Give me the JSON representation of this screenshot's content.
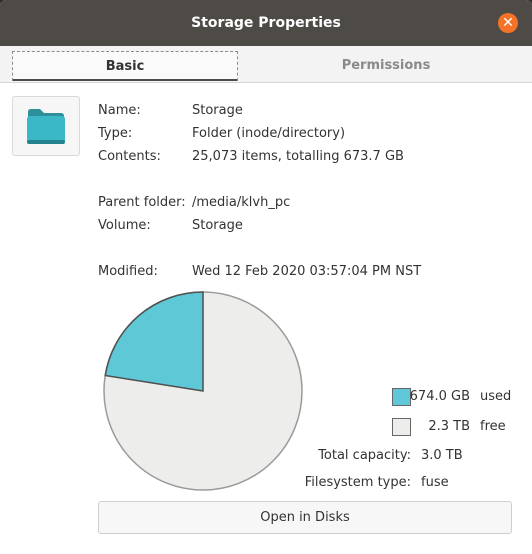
{
  "window": {
    "title": "Storage Properties"
  },
  "tabs": {
    "basic": "Basic",
    "permissions": "Permissions"
  },
  "info": {
    "name_label": "Name:",
    "name_value": "Storage",
    "type_label": "Type:",
    "type_value": "Folder (inode/directory)",
    "contents_label": "Contents:",
    "contents_value": "25,073 items, totalling 673.7 GB",
    "parent_label": "Parent folder:",
    "parent_value": "/media/klvh_pc",
    "volume_label": "Volume:",
    "volume_value": "Storage",
    "modified_label": "Modified:",
    "modified_value": "Wed 12 Feb 2020 03:57:04 PM NST"
  },
  "usage": {
    "used_value": "674.0 GB",
    "used_label": "used",
    "free_value": "2.3 TB",
    "free_label": "free",
    "used_fraction": 0.225,
    "used_color": "#5fc8d6",
    "free_color": "#ededeb",
    "capacity_label": "Total capacity:",
    "capacity_value": "3.0 TB",
    "fstype_label": "Filesystem type:",
    "fstype_value": "fuse"
  },
  "actions": {
    "open_disks": "Open in Disks"
  },
  "icons": {
    "close": "close-icon",
    "folder": "folder-icon"
  }
}
